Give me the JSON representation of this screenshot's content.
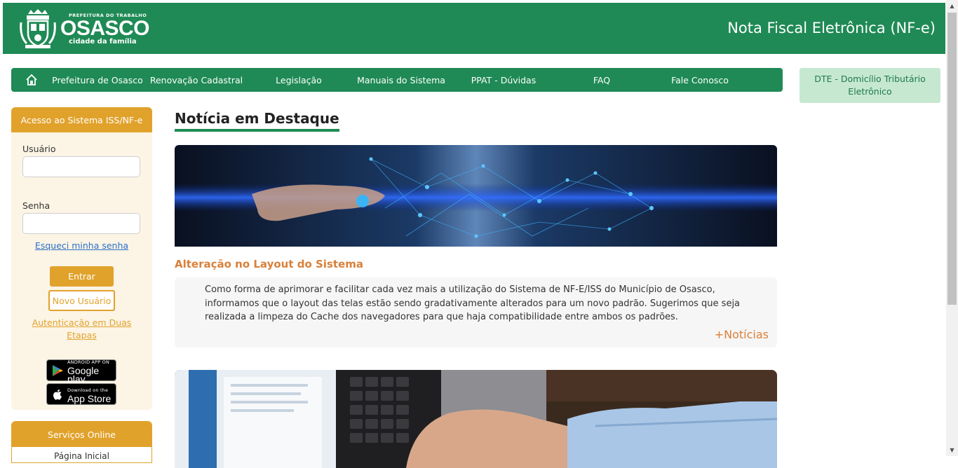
{
  "header": {
    "logo": {
      "small": "PREFEITURA DO TRABALHO",
      "name": "OSASCO",
      "tagline": "cidade da família"
    },
    "title": "Nota Fiscal Eletrônica (NF-e)"
  },
  "nav": {
    "items": [
      {
        "label": "Prefeitura de Osasco"
      },
      {
        "label": "Renovação Cadastral"
      },
      {
        "label": "Legislação"
      },
      {
        "label": "Manuais do Sistema"
      },
      {
        "label": "PPAT - Dúvidas"
      },
      {
        "label": "FAQ"
      },
      {
        "label": "Fale Conosco"
      }
    ]
  },
  "dte": {
    "label": "DTE - Domicílio Tributário Eletrônico"
  },
  "login": {
    "title": "Acesso ao Sistema ISS/NF-e",
    "user_label": "Usuário",
    "user_value": "",
    "password_label": "Senha",
    "password_value": "",
    "forgot": "Esqueci minha senha",
    "enter": "Entrar",
    "new_user": "Novo Usuário",
    "two_factor": "Autenticação em Duas Etapas",
    "google_play_small": "ANDROID APP ON",
    "google_play_big": "Google play",
    "app_store_small": "Download on the",
    "app_store_big": "App Store"
  },
  "services": {
    "title": "Serviços Online",
    "first_item": "Página Inicial"
  },
  "main": {
    "section_title": "Notícia em Destaque",
    "news_title": "Alteração no Layout do Sistema",
    "news_body": "Como forma de aprimorar e facilitar cada vez mais a utilização do Sistema de NF-E/ISS do Município de Osasco, informamos que o layout das telas estão sendo gradativamente alterados para um novo padrão. Sugerimos que seja realizada a limpeza do Cache dos navegadores para que haja compatibilidade entre ambos os padrões.",
    "more": "+Notícias"
  },
  "colors": {
    "brand_green": "#1f8a55",
    "accent_orange": "#e1a22b",
    "news_title": "#d9803a",
    "dte_bg": "#c6e8d1"
  }
}
